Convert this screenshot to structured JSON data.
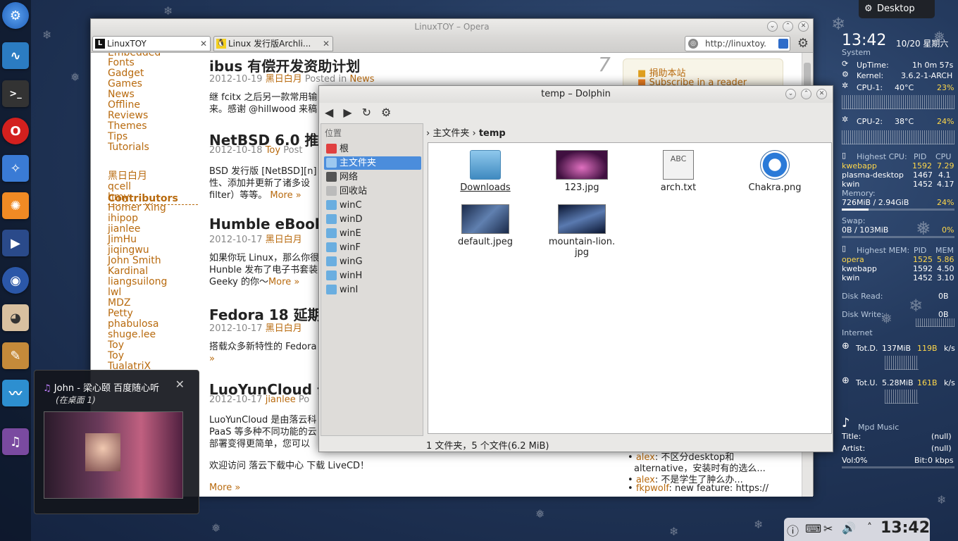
{
  "desktop_button": "Desktop",
  "opera": {
    "title": "LinuxTOY – Opera",
    "tabs": [
      {
        "label": "LinuxTOY"
      },
      {
        "label": "Linux 发行版Archli..."
      }
    ],
    "url": "http://linuxtoy.",
    "categories": [
      "Embedded",
      "Fonts",
      "Gadget",
      "Games",
      "News",
      "Offline",
      "Reviews",
      "Themes",
      "Tips",
      "Tutorials"
    ],
    "contributors_heading": "Contributors",
    "contributors": [
      "黑日白月",
      "qcell",
      "hmy",
      "Homer Xing",
      "ihipop",
      "jianlee",
      "JimHu",
      "jiqingwu",
      "John Smith",
      "Kardinal",
      "liangsuilong",
      "lwl",
      "MDZ",
      "Petty",
      "phabulosa",
      "shuge.lee",
      "Toy",
      "Toy",
      "TualatriX"
    ],
    "posts": [
      {
        "title": "ibus 有偿开发资助计划",
        "date": "2012-10-19",
        "author": "黑日白月",
        "posted_in": "Posted in",
        "category": "News",
        "text1": "继 fcitx 之后另一款常用输",
        "text2": "来。感谢 @hillwood 来稿",
        "comment_count": "7"
      },
      {
        "title": "NetBSD 6.0 推出",
        "date": "2012-10-18",
        "author": "Toy",
        "posted_in": "Post",
        "text1": "BSD 发行版 [NetBSD][n]",
        "text2": "性、添加并更新了诸多设",
        "text3": "filter）等等。",
        "more": "More »"
      },
      {
        "title": "Humble eBook",
        "date": "2012-10-17",
        "author": "黑日白月",
        "text1": "如果你玩 Linux，那么你很",
        "text2": "Hunble 发布了电子书套装",
        "text3": "Geeky 的你～",
        "more": "More »"
      },
      {
        "title": "Fedora 18 延期至",
        "date": "2012-10-17",
        "author": "黑日白月",
        "text1": "搭载众多新特性的 Fedora",
        "more": "»"
      },
      {
        "title": "LuoYunCloud 云",
        "date": "2012-10-17",
        "author": "jianlee",
        "posted_in": "Po",
        "text1": "LuoYunCloud 是由落云科",
        "text2": "PaaS 等多种不同功能的云",
        "text3": "部署变得更简单，您可以",
        "text4": "欢迎访问 落云下载中心 下载 LiveCD！",
        "link4": "落云下载中心",
        "more": "More »"
      }
    ],
    "sidebar": {
      "donate": "捐助本站",
      "subscribe": "Subscribe in a reader"
    },
    "comments": [
      {
        "author": "alex",
        "text": ": 不区分desktop和"
      },
      {
        "author": "",
        "text": "alternative，安装时有的选么..."
      },
      {
        "author": "alex",
        "text": ": 不是学生了肿么办..."
      },
      {
        "author": "fkpwolf",
        "text": ": new feature: https://"
      }
    ]
  },
  "dolphin": {
    "title": "temp – Dolphin",
    "places_header": "位置",
    "places": [
      "根",
      "主文件夹",
      "网络",
      "回收站",
      "winC",
      "winD",
      "winE",
      "winF",
      "winG",
      "winH",
      "winI"
    ],
    "breadcrumb": {
      "home": "主文件夹",
      "current": "temp"
    },
    "files": [
      "Downloads",
      "123.jpg",
      "arch.txt",
      "Chakra.png",
      "default.jpeg",
      "mountain-lion.\njpg"
    ],
    "status": "1 文件夹，5 个文件(6.2 MiB)"
  },
  "preview": {
    "title": "John - 梁心颐 百度随心听",
    "subtitle": "(在桌面 1)"
  },
  "monitor": {
    "time": "13:42",
    "date": "10/20 星期六",
    "system": "System",
    "uptime_label": "UpTime:",
    "uptime": "1h 0m 57s",
    "kernel_label": "Kernel:",
    "kernel": "3.6.2-1-ARCH",
    "cpu1_label": "CPU-1:",
    "cpu1_temp": "40°C",
    "cpu1_pct": "23%",
    "cpu1_value": 0.23,
    "cpu2_label": "CPU-2:",
    "cpu2_temp": "38°C",
    "cpu2_pct": "24%",
    "cpu2_value": 0.24,
    "highest_cpu": "Highest CPU:",
    "pid": "PID",
    "cpu": "CPU",
    "cpu_procs": [
      [
        "kwebapp",
        "1592",
        "7.29"
      ],
      [
        "plasma-desktop",
        "1467",
        "4.1"
      ],
      [
        "kwin",
        "1452",
        "4.17"
      ]
    ],
    "memory_label": "Memory:",
    "memory": "726MiB / 2.94GiB",
    "memory_pct": "24%",
    "memory_value": 0.24,
    "swap_label": "Swap:",
    "swap": "0B / 103MiB",
    "swap_pct": "0%",
    "swap_value": 0,
    "highest_mem": "Highest MEM:",
    "mem": "MEM",
    "mem_procs": [
      [
        "opera",
        "1525",
        "5.86"
      ],
      [
        "kwebapp",
        "1592",
        "4.50"
      ],
      [
        "kwin",
        "1452",
        "3.10"
      ]
    ],
    "disk_read_label": "Disk Read:",
    "disk_read": "0B",
    "disk_write_label": "Disk Write:",
    "disk_write": "0B",
    "internet": "Internet",
    "totd_label": "Tot.D.",
    "totd": "137MiB",
    "totd_rate": "119B",
    "totd_unit": "k/s",
    "totu_label": "Tot.U.",
    "totu": "5.28MiB",
    "totu_rate": "161B",
    "totu_unit": "k/s",
    "mpd": "Mpd Music",
    "title_label": "Title:",
    "title_val": "(null)",
    "artist_label": "Artist:",
    "artist_val": "(null)",
    "vol_label": "Vol:",
    "vol": "0%",
    "bit_label": "Bit:",
    "bit": "0 kbps"
  },
  "tray": {
    "clock": "13:42"
  }
}
